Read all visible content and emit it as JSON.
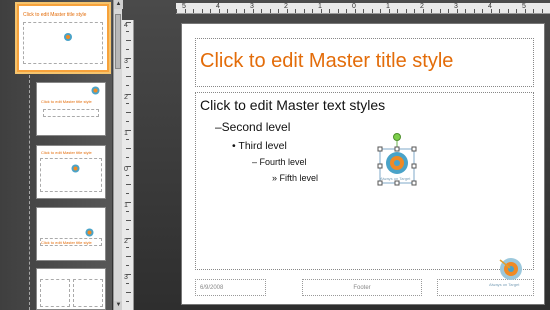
{
  "slide": {
    "title": "Click to edit Master title style",
    "levels": [
      "Click to edit  Master text styles",
      "–Second level",
      "• Third level",
      "– Fourth level",
      "» Fifth level"
    ],
    "footer_date": "6/9/2008",
    "footer_text": "Footer",
    "clipart_caption": "Always on Target"
  },
  "thumbnails": [
    {
      "title": "Click to edit Master title style",
      "selected": true
    },
    {
      "title": "Click to edit Master title style",
      "selected": false
    },
    {
      "title": "Click to edit Master title style",
      "selected": false
    },
    {
      "title": "Click to edit Master title style",
      "selected": false
    },
    {
      "title": "",
      "selected": false
    }
  ],
  "vertical_ruler": [
    "4",
    "3",
    "2",
    "1",
    "0",
    "1",
    "2",
    "3"
  ],
  "horizontal_ruler": [
    "5",
    "4",
    "3",
    "2",
    "1",
    "0",
    "1",
    "2",
    "3",
    "4",
    "5"
  ],
  "colors": {
    "accent": "#e36c09",
    "selection": "#f7a23b"
  }
}
